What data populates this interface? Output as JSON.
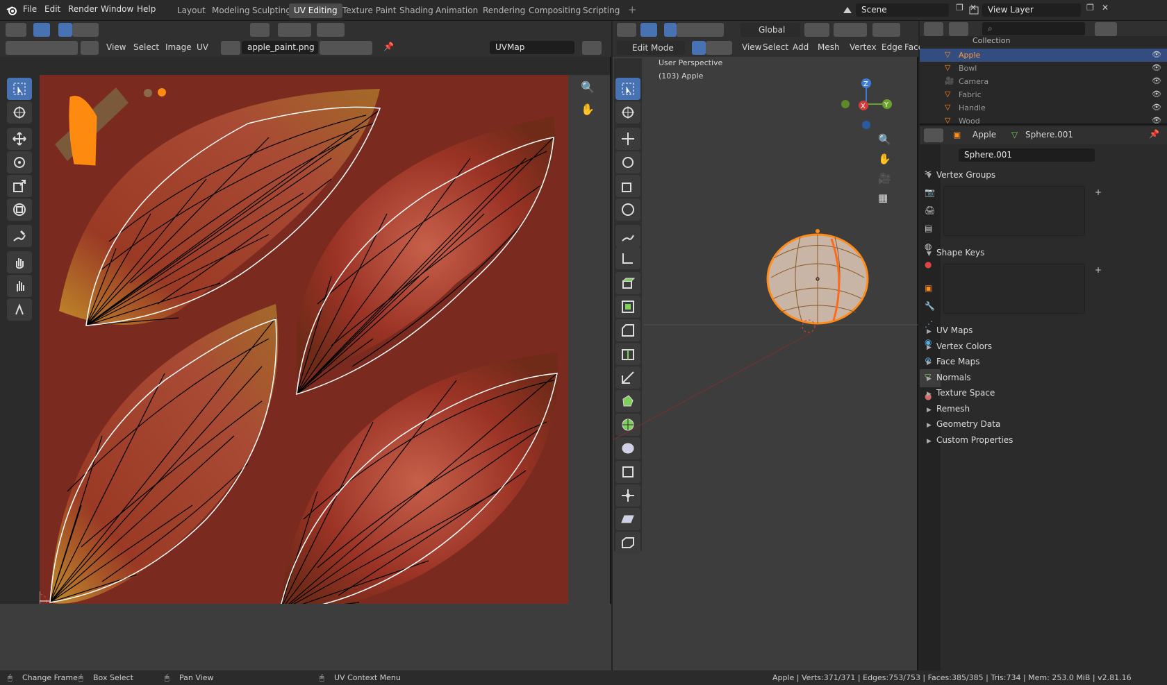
{
  "menu": {
    "file": "File",
    "edit": "Edit",
    "render": "Render",
    "window": "Window",
    "help": "Help"
  },
  "workspaces": [
    "Layout",
    "Modeling",
    "Sculpting",
    "UV Editing",
    "Texture Paint",
    "Shading",
    "Animation",
    "Rendering",
    "Compositing",
    "Scripting"
  ],
  "active_workspace": "UV Editing",
  "scene": "Scene",
  "view_layer": "View Layer",
  "uv_editor": {
    "menus": [
      "View",
      "Select",
      "Image",
      "UV"
    ],
    "image_name": "apple_paint.png",
    "uv_map": "UVMap"
  },
  "viewport": {
    "mode": "Edit Mode",
    "menus": [
      "View",
      "Select",
      "Add",
      "Mesh",
      "Vertex",
      "Edge",
      "Face"
    ],
    "orientation": "Global",
    "overlay_title": "User Perspective",
    "overlay_object": "(103) Apple"
  },
  "outliner": {
    "collection": "Collection",
    "items": [
      {
        "name": "Apple",
        "selected": true
      },
      {
        "name": "Bowl",
        "selected": false
      },
      {
        "name": "Camera",
        "selected": false
      },
      {
        "name": "Fabric",
        "selected": false
      },
      {
        "name": "Handle",
        "selected": false
      },
      {
        "name": "Wood",
        "selected": false
      }
    ]
  },
  "properties": {
    "object_name": "Apple",
    "mesh_name": "Sphere.001",
    "data_field": "Sphere.001",
    "open_panels": [
      "Vertex Groups",
      "Shape Keys"
    ],
    "closed_panels": [
      "UV Maps",
      "Vertex Colors",
      "Face Maps",
      "Normals",
      "Texture Space",
      "Remesh",
      "Geometry Data",
      "Custom Properties"
    ]
  },
  "statusbar": {
    "change_frame": "Change Frame",
    "box_select": "Box Select",
    "pan_view": "Pan View",
    "uv_context": "UV Context Menu",
    "stats": "Apple | Verts:371/371 | Edges:753/753 | Faces:385/385 | Tris:734 | Mem: 253.0 MiB | v2.81.16"
  },
  "colors": {
    "accent": "#4772b3",
    "texture_bg": "#7a2a1f",
    "selection": "#ff8c1a"
  }
}
